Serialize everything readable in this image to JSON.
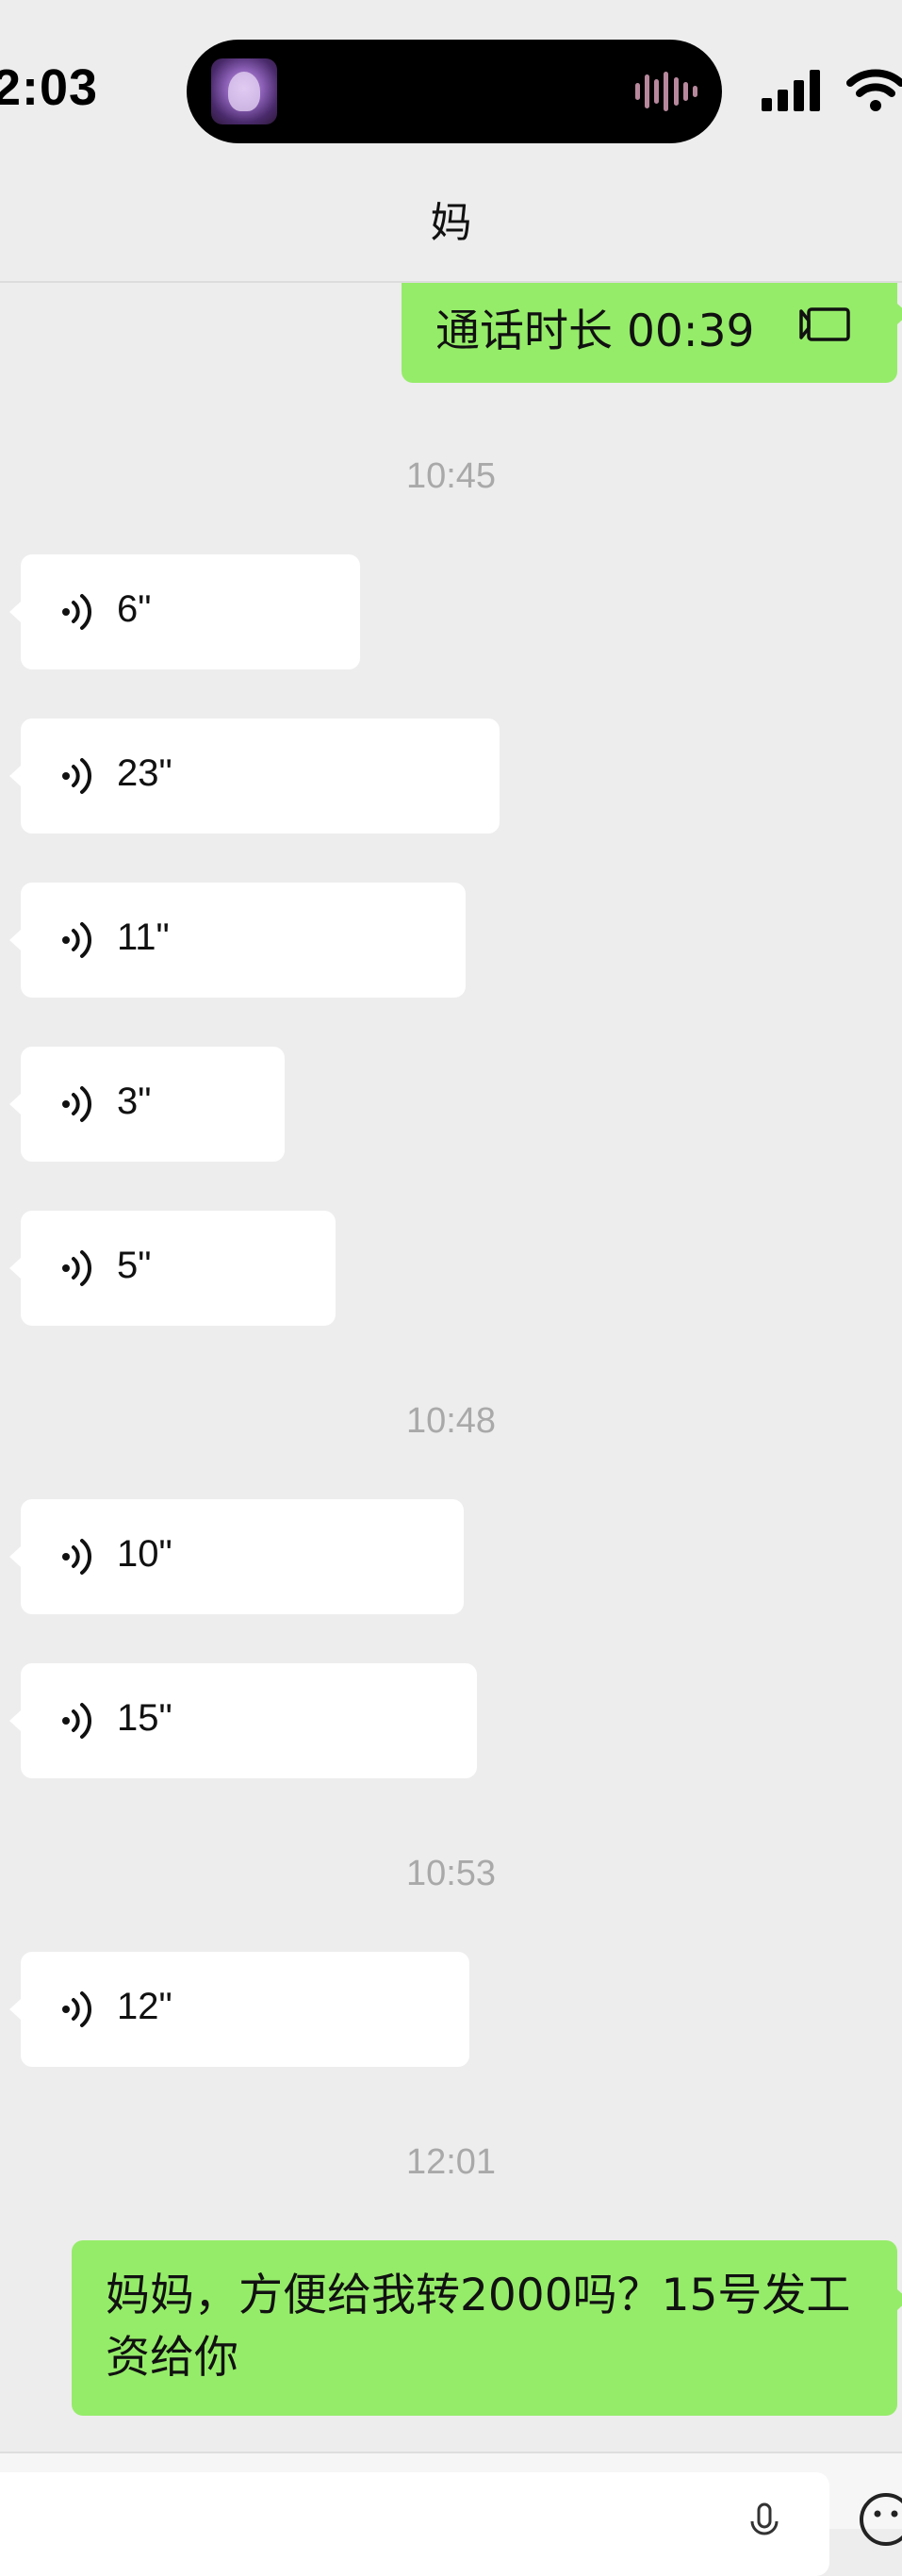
{
  "status": {
    "time": "2:03"
  },
  "nav": {
    "title": "妈"
  },
  "messages": {
    "call": "通话时长 00:39",
    "ts1": "10:45",
    "voice1": "6\"",
    "voice2": "23\"",
    "voice3": "11\"",
    "voice4": "3\"",
    "voice5": "5\"",
    "ts2": "10:48",
    "voice6": "10\"",
    "voice7": "15\"",
    "ts3": "10:53",
    "voice8": "12\"",
    "ts4": "12:01",
    "text1": "妈妈，方便给我转2000吗？15号发工资给你"
  },
  "colors": {
    "background": "#ededed",
    "incoming_bubble": "#ffffff",
    "outgoing_bubble": "#95ec69",
    "timestamp": "#a9a9a9"
  },
  "icons": {
    "voice": "voice-wave-icon",
    "call": "video-call-icon",
    "mic": "microphone-icon",
    "emoji": "emoji-icon",
    "signal": "cellular-signal-icon",
    "wifi": "wifi-icon"
  }
}
